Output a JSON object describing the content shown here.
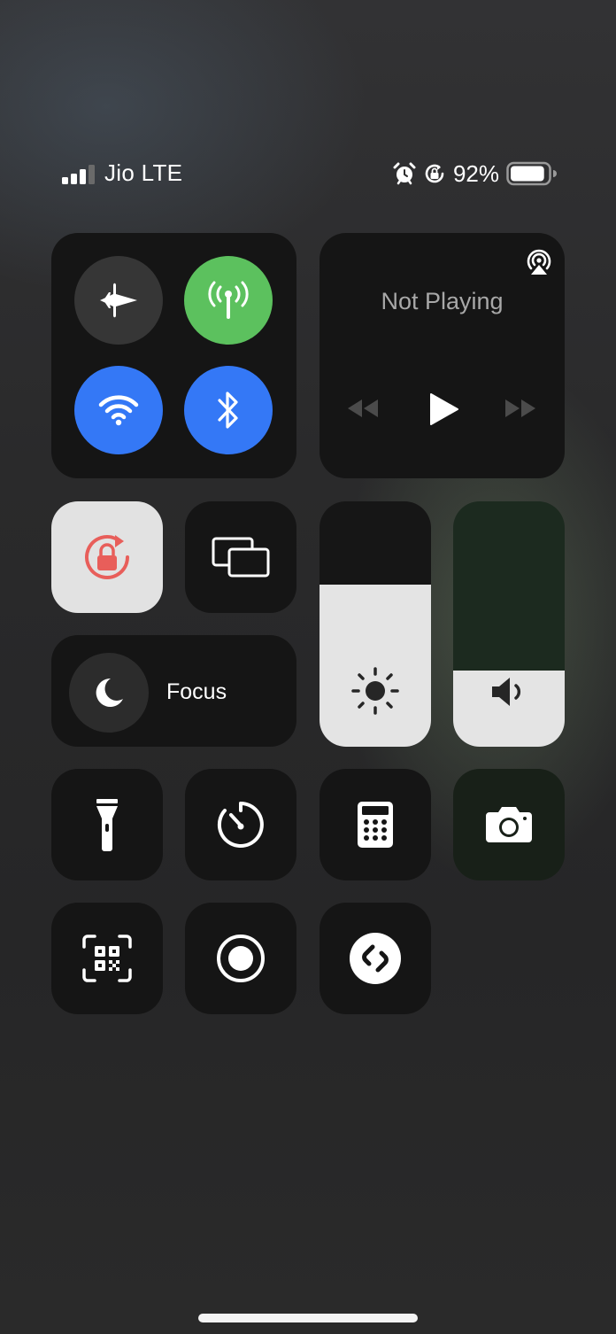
{
  "status_bar": {
    "carrier": "Jio LTE",
    "battery_percent": "92%",
    "battery_level": 0.92,
    "signal_bars": 3,
    "icons": [
      "alarm-icon",
      "orientation-lock-icon",
      "battery-icon"
    ]
  },
  "connectivity": {
    "airplane_mode": {
      "icon": "airplane-icon",
      "on": false
    },
    "cellular_data": {
      "icon": "antenna-icon",
      "on": true,
      "color": "#5cc15e"
    },
    "wifi": {
      "icon": "wifi-icon",
      "on": true,
      "color": "#3478f6"
    },
    "bluetooth": {
      "icon": "bluetooth-icon",
      "on": true,
      "color": "#3478f6"
    }
  },
  "now_playing": {
    "title": "Not Playing",
    "icons": [
      "airplay-icon",
      "rewind-icon",
      "play-icon",
      "fast-forward-icon"
    ]
  },
  "orientation_lock": {
    "icon": "orientation-lock-icon",
    "on": true,
    "accent": "#e85e5a"
  },
  "screen_mirroring": {
    "icon": "screen-mirroring-icon"
  },
  "focus": {
    "label": "Focus",
    "icon": "moon-icon"
  },
  "brightness": {
    "icon": "sun-icon",
    "level": 0.66
  },
  "volume": {
    "icon": "speaker-icon",
    "level": 0.31
  },
  "controls_row_1": [
    "flashlight-icon",
    "timer-icon",
    "calculator-icon",
    "camera-icon"
  ],
  "controls_row_2": [
    "qr-code-icon",
    "screen-record-icon",
    "shazam-icon"
  ]
}
